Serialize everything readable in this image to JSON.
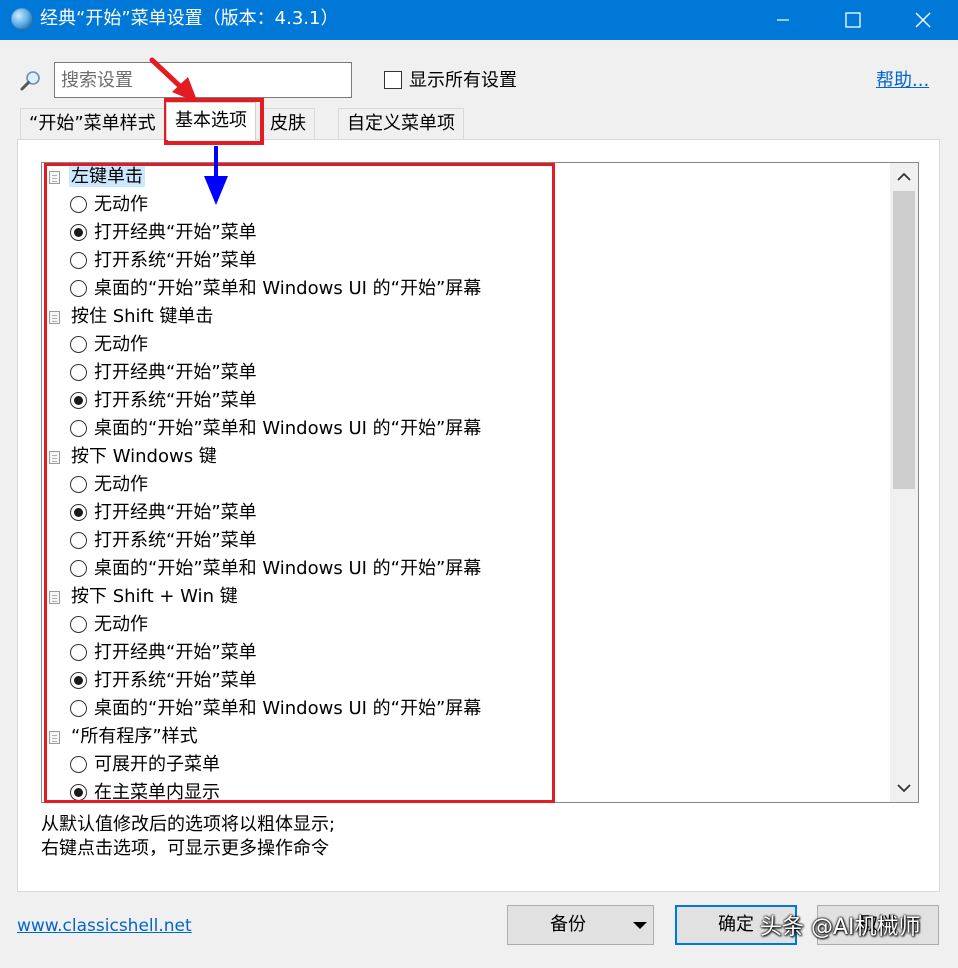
{
  "window": {
    "title": "经典“开始”菜单设置（版本：4.3.1）",
    "title_bar_color": "#0078d7"
  },
  "icons": {
    "app": "classic-shell-shell-icon",
    "search": "magnifier-icon",
    "minimize": "minimize-icon",
    "maximize": "maximize-icon",
    "close": "close-icon"
  },
  "search": {
    "placeholder": "搜索设置",
    "value": ""
  },
  "show_all": {
    "label": "显示所有设置",
    "checked": false
  },
  "help": {
    "label": "帮助..."
  },
  "tabs": [
    {
      "label": "“开始”菜单样式",
      "active": false
    },
    {
      "label": "基本选项",
      "active": true
    },
    {
      "label": "皮肤",
      "active": false
    },
    {
      "label": "自定义菜单项",
      "active": false
    }
  ],
  "settings": [
    {
      "label": "左键单击",
      "selected": true,
      "options": [
        {
          "label": "无动作",
          "checked": false
        },
        {
          "label": "打开经典“开始”菜单",
          "checked": true
        },
        {
          "label": "打开系统“开始”菜单",
          "checked": false
        },
        {
          "label": "桌面的“开始”菜单和 Windows UI 的“开始”屏幕",
          "checked": false
        }
      ]
    },
    {
      "label": "按住 Shift 键单击",
      "selected": false,
      "options": [
        {
          "label": "无动作",
          "checked": false
        },
        {
          "label": "打开经典“开始”菜单",
          "checked": false
        },
        {
          "label": "打开系统“开始”菜单",
          "checked": true
        },
        {
          "label": "桌面的“开始”菜单和 Windows UI 的“开始”屏幕",
          "checked": false
        }
      ]
    },
    {
      "label": "按下 Windows 键",
      "selected": false,
      "options": [
        {
          "label": "无动作",
          "checked": false
        },
        {
          "label": "打开经典“开始”菜单",
          "checked": true
        },
        {
          "label": "打开系统“开始”菜单",
          "checked": false
        },
        {
          "label": "桌面的“开始”菜单和 Windows UI 的“开始”屏幕",
          "checked": false
        }
      ]
    },
    {
      "label": "按下 Shift + Win 键",
      "selected": false,
      "options": [
        {
          "label": "无动作",
          "checked": false
        },
        {
          "label": "打开经典“开始”菜单",
          "checked": false
        },
        {
          "label": "打开系统“开始”菜单",
          "checked": true
        },
        {
          "label": "桌面的“开始”菜单和 Windows UI 的“开始”屏幕",
          "checked": false
        }
      ]
    },
    {
      "label": "“所有程序”样式",
      "selected": false,
      "options": [
        {
          "label": "可展开的子菜单",
          "checked": false
        },
        {
          "label": "在主菜单内显示",
          "checked": true
        }
      ]
    }
  ],
  "hints": {
    "line1": "从默认值修改后的选项将以粗体显示;",
    "line2": "右键点击选项，可显示更多操作命令"
  },
  "footer": {
    "website": "www.classicshell.net",
    "backup_label": "备份",
    "ok_label": "确定",
    "cancel_label": "取消",
    "watermark": "头条 @AI机械师"
  },
  "annotations": {
    "highlight_color": "#e31b23",
    "arrow_red": "#e31b23",
    "arrow_blue": "#0000ff"
  }
}
